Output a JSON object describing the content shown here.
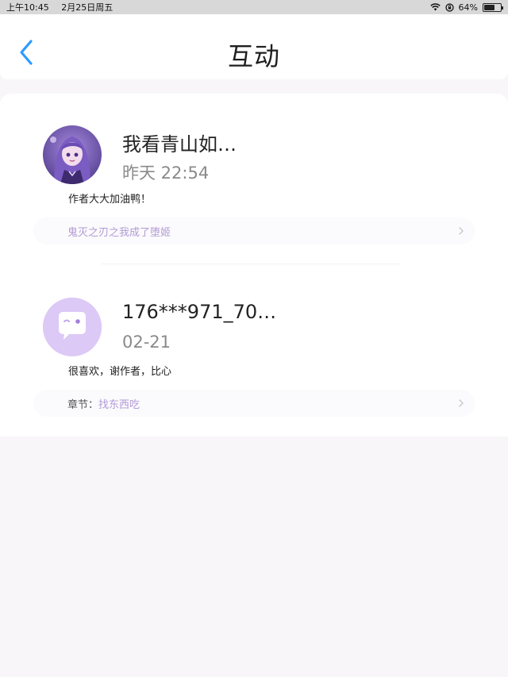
{
  "status_bar": {
    "time": "上午10:45",
    "date": "2月25日周五",
    "battery": "64%",
    "battery_level": 0.64
  },
  "header": {
    "title": "互动",
    "back_icon": "chevron-left-icon"
  },
  "comments": [
    {
      "user": "我看青山如…",
      "time": "昨天 22:54",
      "text": "作者大大加油鸭！",
      "source_prefix": "",
      "source_link": "鬼灭之刃之我成了堕姬",
      "avatar": "anime-girl-avatar"
    },
    {
      "user": "176***971_70…",
      "time": "02-21",
      "text": "很喜欢，谢作者，比心",
      "source_prefix": "章节：",
      "source_link": "找东西吃",
      "avatar": "chat-bubble-avatar"
    }
  ],
  "colors": {
    "accent_blue": "#2f9bff",
    "link_purple": "#b29ad6",
    "avatar_lavender": "#dcc9f6"
  }
}
